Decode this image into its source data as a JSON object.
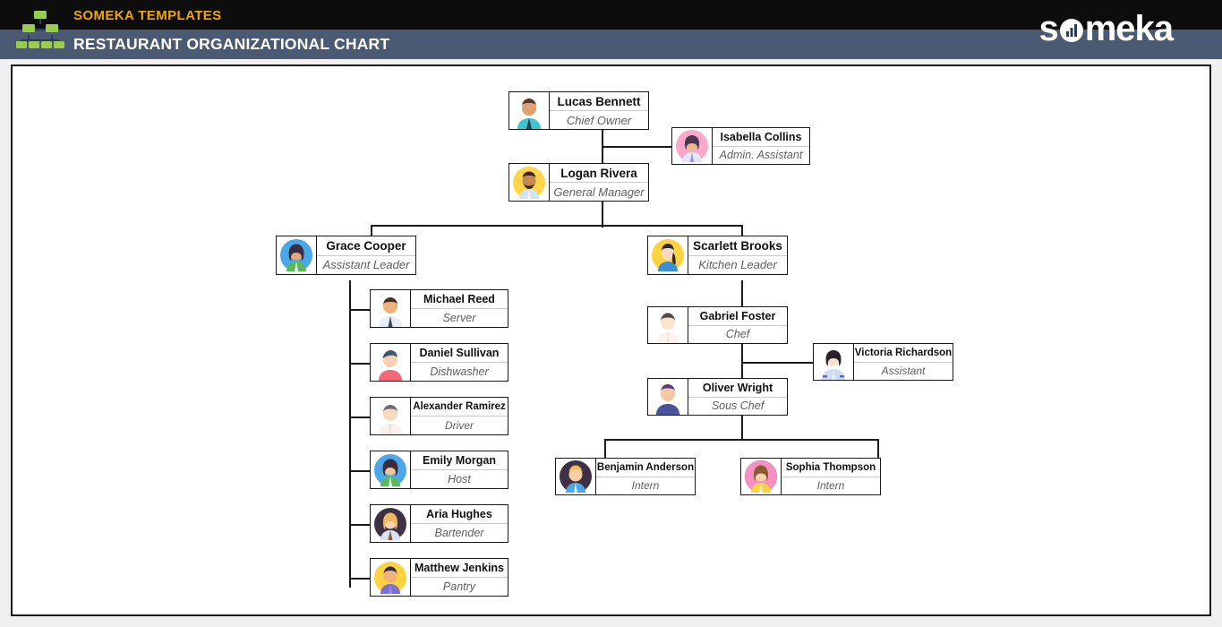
{
  "header": {
    "templates_label": "SOMEKA TEMPLATES",
    "chart_title": "RESTAURANT ORGANIZATIONAL CHART",
    "brand": "someka",
    "brand_part1": "s",
    "brand_part2": "meka",
    "logo_icon": "org-chart-icon",
    "colors": {
      "top_bar": "#0d0d0d",
      "title_bar": "#4a5a72",
      "accent": "#f0a500",
      "logo_green": "#9acd4e"
    }
  },
  "chart_data": {
    "type": "tree",
    "title": "RESTAURANT ORGANIZATIONAL CHART",
    "nodes": [
      {
        "id": "lucas",
        "name": "Lucas Bennett",
        "role": "Chief Owner",
        "parent": null,
        "relation": "root"
      },
      {
        "id": "isabella",
        "name": "Isabella Collins",
        "role": "Admin. Assistant",
        "parent": "lucas",
        "relation": "assistant"
      },
      {
        "id": "logan",
        "name": "Logan Rivera",
        "role": "General Manager",
        "parent": "lucas",
        "relation": "child"
      },
      {
        "id": "grace",
        "name": "Grace Cooper",
        "role": "Assistant Leader",
        "parent": "logan",
        "relation": "child"
      },
      {
        "id": "scarlett",
        "name": "Scarlett Brooks",
        "role": "Kitchen Leader",
        "parent": "logan",
        "relation": "child"
      },
      {
        "id": "michael",
        "name": "Michael Reed",
        "role": "Server",
        "parent": "grace",
        "relation": "child"
      },
      {
        "id": "daniel",
        "name": "Daniel Sullivan",
        "role": "Dishwasher",
        "parent": "grace",
        "relation": "child"
      },
      {
        "id": "alexander",
        "name": "Alexander Ramirez",
        "role": "Driver",
        "parent": "grace",
        "relation": "child"
      },
      {
        "id": "emily",
        "name": "Emily Morgan",
        "role": "Host",
        "parent": "grace",
        "relation": "child"
      },
      {
        "id": "aria",
        "name": "Aria Hughes",
        "role": "Bartender",
        "parent": "grace",
        "relation": "child"
      },
      {
        "id": "matthew",
        "name": "Matthew Jenkins",
        "role": "Pantry",
        "parent": "grace",
        "relation": "child"
      },
      {
        "id": "gabriel",
        "name": "Gabriel Foster",
        "role": "Chef",
        "parent": "scarlett",
        "relation": "child"
      },
      {
        "id": "victoria",
        "name": "Victoria Richardson",
        "role": "Assistant",
        "parent": "gabriel",
        "relation": "assistant"
      },
      {
        "id": "oliver",
        "name": "Oliver Wright",
        "role": "Sous Chef",
        "parent": "gabriel",
        "relation": "child"
      },
      {
        "id": "benjamin",
        "name": "Benjamin Anderson",
        "role": "Intern",
        "parent": "oliver",
        "relation": "child"
      },
      {
        "id": "sophia",
        "name": "Sophia Thompson",
        "role": "Intern",
        "parent": "oliver",
        "relation": "child"
      }
    ]
  }
}
